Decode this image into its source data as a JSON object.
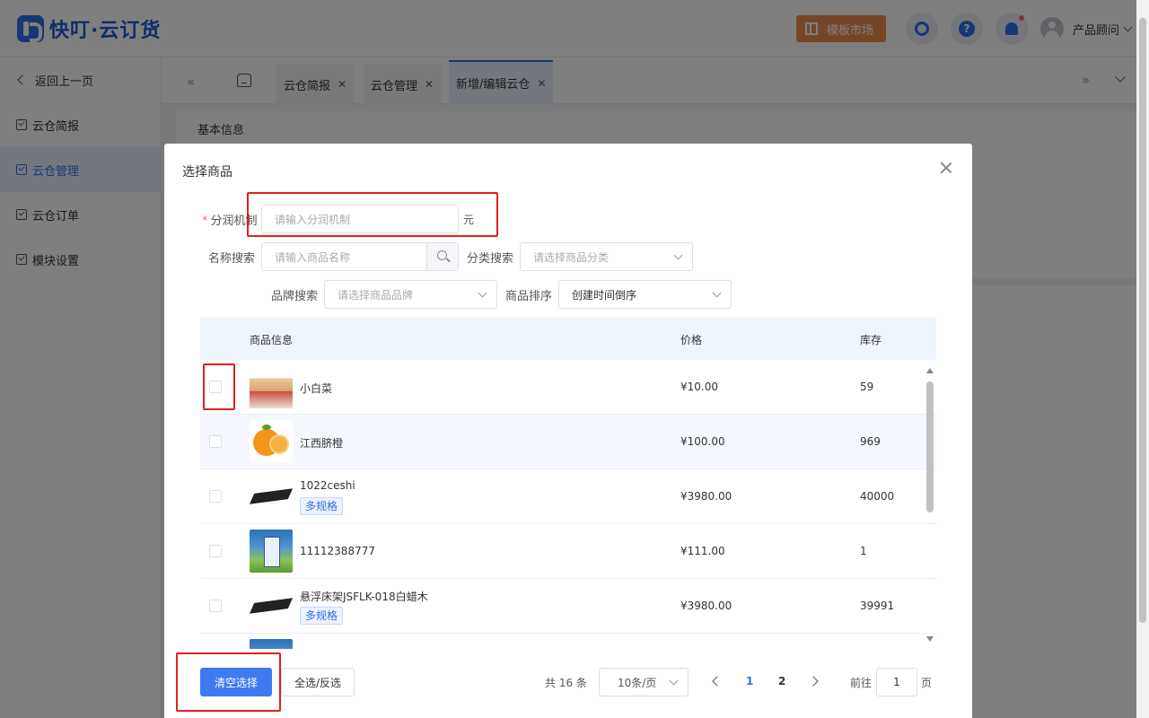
{
  "header": {
    "logo_text": "快叮·云订货",
    "template_market": "模板市场",
    "user_name": "产品顾问"
  },
  "sidebar": {
    "back": "返回上一页",
    "items": [
      {
        "label": "云仓简报"
      },
      {
        "label": "云仓管理"
      },
      {
        "label": "云仓订单"
      },
      {
        "label": "模块设置"
      }
    ]
  },
  "tabs": {
    "nav_left": "«",
    "nav_right": "»",
    "items": [
      {
        "label": "云仓简报",
        "close": "✕"
      },
      {
        "label": "云仓管理",
        "close": "✕"
      },
      {
        "label": "新增/编辑云仓",
        "close": "✕"
      }
    ]
  },
  "content": {
    "section_title": "基本信息"
  },
  "dialog": {
    "title": "选择商品",
    "fields": {
      "profit_label": "分润机制",
      "profit_required": "*",
      "profit_placeholder": "请输入分润机制",
      "profit_unit": "元",
      "name_label": "名称搜索",
      "name_placeholder": "请输入商品名称",
      "category_label": "分类搜索",
      "category_placeholder": "请选择商品分类",
      "brand_label": "品牌搜索",
      "brand_placeholder": "请选择商品品牌",
      "sort_label": "商品排序",
      "sort_value": "创建时间倒序"
    },
    "table": {
      "headers": {
        "info": "商品信息",
        "price": "价格",
        "stock": "库存"
      },
      "rows": [
        {
          "name": "小白菜",
          "tag": "",
          "price": "¥10.00",
          "stock": "59",
          "image": "cabbage-package"
        },
        {
          "name": "江西脐橙",
          "tag": "",
          "price": "¥100.00",
          "stock": "969",
          "image": "oranges"
        },
        {
          "name": "1022ceshi",
          "tag": "多规格",
          "price": "¥3980.00",
          "stock": "40000",
          "image": "black-bed-board"
        },
        {
          "name": "11112388777",
          "tag": "",
          "price": "¥111.00",
          "stock": "1",
          "image": "milk-carton"
        },
        {
          "name": "悬浮床架JSFLK-018白蜡木",
          "tag": "多规格",
          "price": "¥3980.00",
          "stock": "39991",
          "image": "black-bed-board"
        }
      ]
    },
    "footer": {
      "clear_button": "清空选择",
      "select_all_button": "全选/反选",
      "total_text": "共 16 条",
      "page_size": "10条/页",
      "pages": [
        "1",
        "2"
      ],
      "current_page": "1",
      "goto_label": "前往",
      "goto_value": "1",
      "goto_unit": "页"
    }
  },
  "colors": {
    "primary": "#2f6ee8",
    "highlight_box": "#e02020",
    "template_button": "#e8823f"
  }
}
